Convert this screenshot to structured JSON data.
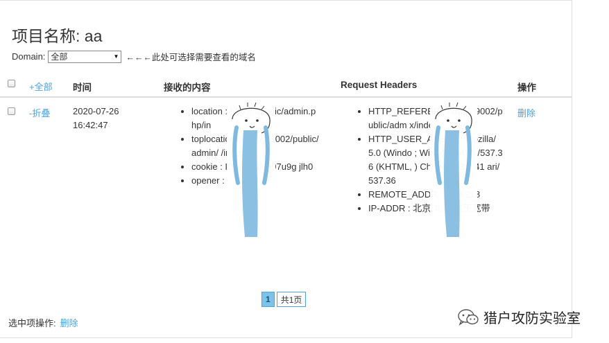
{
  "page": {
    "title": "项目名称: aa",
    "domain_label": "Domain:",
    "domain_selected": "全部",
    "domain_hint": "←←←此处可选择需要查看的域名"
  },
  "table": {
    "columns": {
      "select_all": "+全部",
      "time": "时间",
      "content": "接收的内容",
      "headers": "Request Headers",
      "actions": "操作"
    },
    "rows": [
      {
        "toggle": "-折叠",
        "date": "2020-07-26",
        "time": "16:42:47",
        "content": [
          "location : http://          /public/admin.php/in",
          "toplocation : http://          :9002/public/admin/          /index",
          "cookie :              ID=pb3i6uq97u9g          jlh0",
          "opener :"
        ],
        "headers": [
          "HTTP_REFERER : http://          :9002/public/adm          x/index",
          "HTTP_USER_AGENT : Mozilla/5.0 (Windo          ; Win64; x64) A          /537.36 (KHTML,          ) Chrome/83.0.41          ari/537.36",
          "REMOTE_ADDR : 1           43.218",
          "IP-ADDR : 北京 北京 方正宽带"
        ],
        "action": "删除"
      }
    ]
  },
  "pagination": {
    "current": "1",
    "total": "共1页"
  },
  "footer": {
    "label": "选中项操作:",
    "action": "删除"
  },
  "watermark": {
    "text": "猎户攻防实验室",
    "icon": "wechat-icon"
  },
  "colors": {
    "link": "#4aa3df",
    "page_active": "#7cc3ea",
    "doodle": "#7fb9e0"
  }
}
